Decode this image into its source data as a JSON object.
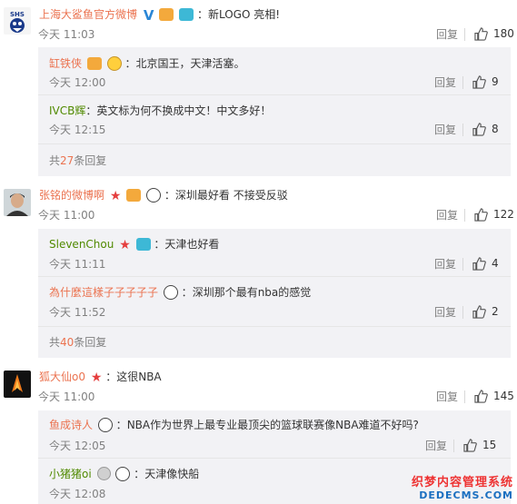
{
  "actions": {
    "reply": "回复"
  },
  "comments": [
    {
      "user": "上海大鲨鱼官方微博",
      "colon": "：",
      "text": "新LOGO 亮相!",
      "time": "今天 11:03",
      "likes": "180",
      "replies": [
        {
          "user": "缸铁侠",
          "colon": "：",
          "text": "北京国王，天津活塞。",
          "time": "今天 12:00",
          "likes": "9"
        },
        {
          "user": "IVCB辉",
          "colon": "：",
          "text": "英文标为何不换成中文！中文多好！",
          "time": "今天 12:15",
          "likes": "8"
        }
      ],
      "more": {
        "prefix": "共",
        "count": "27",
        "suffix": "条回复"
      }
    },
    {
      "user": "张铭的微博啊",
      "colon": "：",
      "text": "深圳最好看 不接受反驳",
      "time": "今天 11:00",
      "likes": "122",
      "replies": [
        {
          "user": "SlevenChou",
          "colon": "：",
          "text": "天津也好看",
          "time": "今天 11:11",
          "likes": "4"
        },
        {
          "user": "為什麼這樣子子子子子",
          "colon": "：",
          "text": "深圳那个最有nba的感觉",
          "time": "今天 11:52",
          "likes": "2"
        }
      ],
      "more": {
        "prefix": "共",
        "count": "40",
        "suffix": "条回复"
      }
    },
    {
      "user": "狐大仙o0",
      "colon": "：",
      "text": "这很NBA",
      "time": "今天 11:00",
      "likes": "145",
      "replies": [
        {
          "user": "鱼成诗人",
          "colon": "：",
          "text": "NBA作为世界上最专业最顶尖的篮球联赛像NBA难道不好吗?",
          "time": "今天 12:05",
          "likes": "15"
        },
        {
          "user": "小猪猪oi",
          "colon": "：",
          "text": "天津像快船",
          "time": "今天 12:08",
          "likes": ""
        }
      ]
    }
  ],
  "watermark": {
    "line1": "织梦内容管理系统",
    "line2": "DEDECMS.COM"
  },
  "colors": {
    "username": "#eb7350",
    "username_green": "#508a00",
    "reply_box": "#f2f2f5",
    "meta": "#808080"
  },
  "icons": [
    "thumbs-up-icon",
    "verified-v-icon",
    "camera-icon",
    "panda-emoji-icon",
    "star-icon"
  ]
}
